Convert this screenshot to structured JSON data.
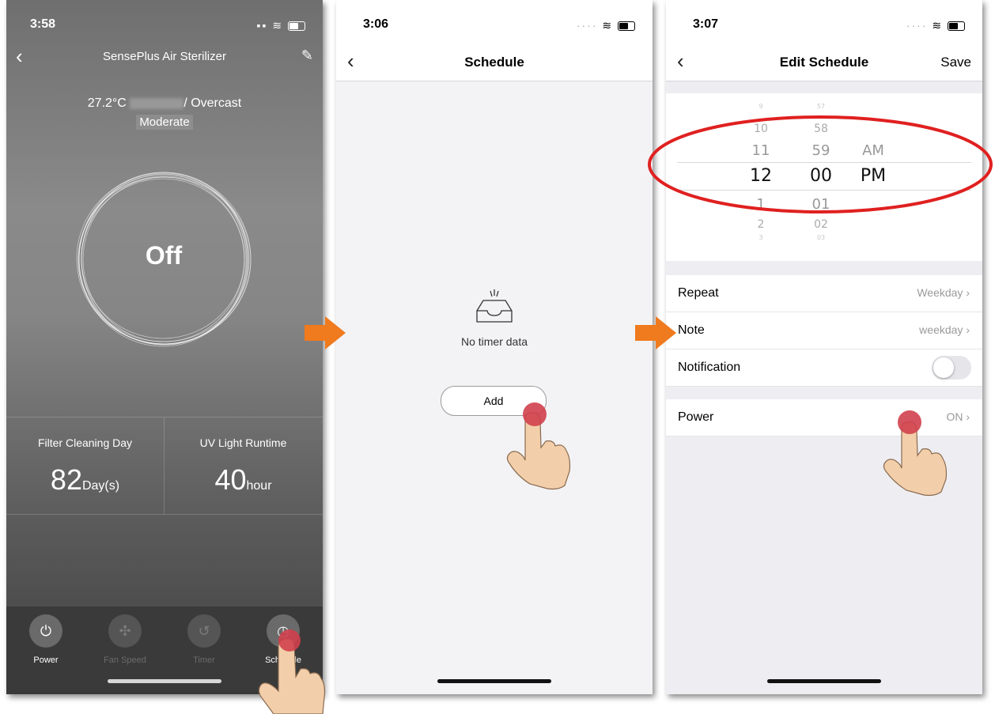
{
  "screen1": {
    "status_time": "3:58",
    "title": "SensePlus Air Sterilizer",
    "temperature": "27.2°C",
    "weather": "/ Overcast",
    "air_quality": "Moderate",
    "power_state": "Off",
    "filter": {
      "label": "Filter Cleaning Day",
      "value": "82",
      "unit": "Day(s)"
    },
    "uv": {
      "label": "UV Light Runtime",
      "value": "40",
      "unit": "hour"
    },
    "tabs": [
      {
        "label": "Power",
        "icon": "power-icon"
      },
      {
        "label": "Fan Speed",
        "icon": "fan-icon"
      },
      {
        "label": "Timer",
        "icon": "timer-icon"
      },
      {
        "label": "Schedule",
        "icon": "clock-icon"
      }
    ]
  },
  "screen2": {
    "status_time": "3:06",
    "title": "Schedule",
    "empty_text": "No timer data",
    "add_label": "Add"
  },
  "screen3": {
    "status_time": "3:07",
    "title": "Edit Schedule",
    "save_label": "Save",
    "picker": {
      "hours": [
        "9",
        "10",
        "11",
        "12",
        "1",
        "2",
        "3"
      ],
      "minutes": [
        "57",
        "58",
        "59",
        "00",
        "01",
        "02",
        "03"
      ],
      "ampm": [
        "AM",
        "PM"
      ],
      "selected": {
        "hour": "12",
        "minute": "00",
        "ampm": "PM"
      }
    },
    "repeat": {
      "label": "Repeat",
      "value": "Weekday"
    },
    "note": {
      "label": "Note",
      "value": "weekday"
    },
    "notification": {
      "label": "Notification",
      "enabled": false
    },
    "power": {
      "label": "Power",
      "value": "ON"
    }
  },
  "colors": {
    "arrow": "#f07a1e",
    "highlight_ellipse": "#e02020",
    "tap_dot": "#d0404c",
    "hand": "#f2cfaa"
  }
}
